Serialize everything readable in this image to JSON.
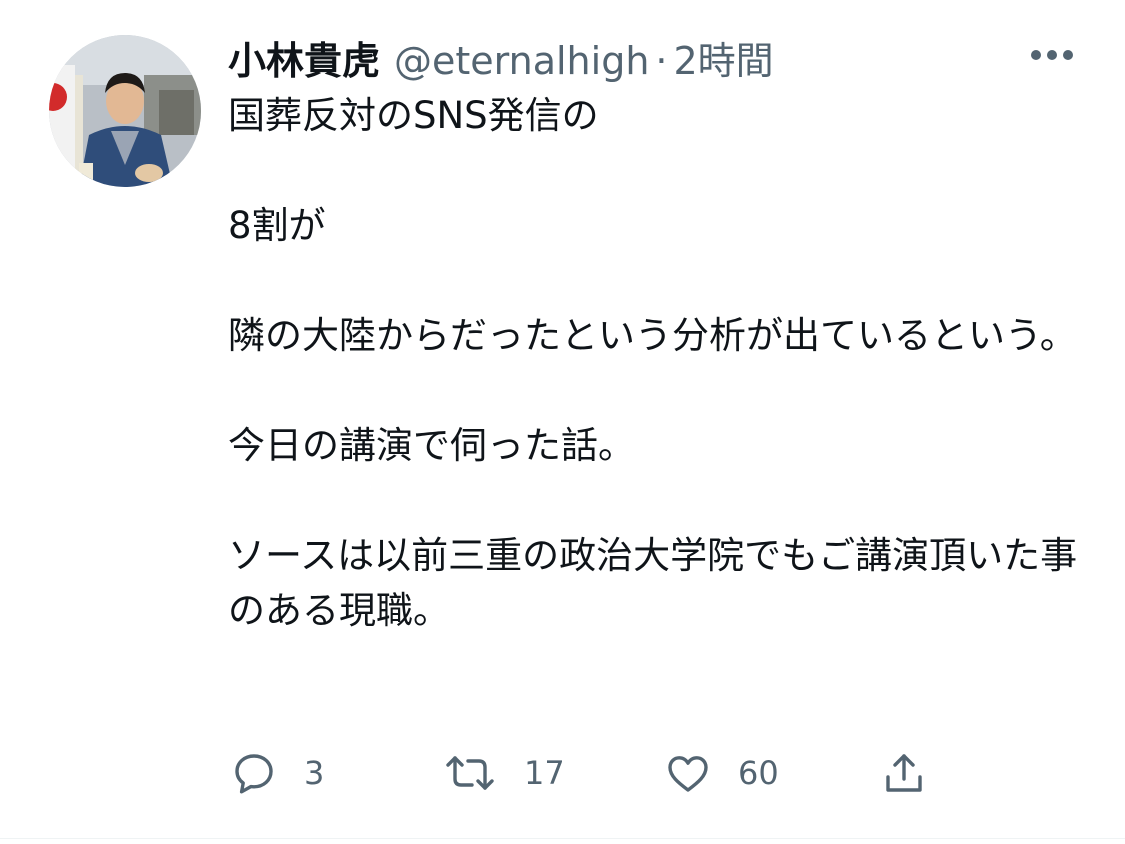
{
  "user": {
    "display_name": "小林貴虎",
    "handle": "@eternalhigh",
    "separator": "·",
    "timestamp": "2時間"
  },
  "tweet": {
    "text": "国葬反対のSNS発信の\n\n8割が\n\n隣の大陸からだったという分析が出ているという。\n\n今日の講演で伺った話。\n\nソースは以前三重の政治大学院でもご講演頂いた事のある現職。"
  },
  "actions": {
    "reply_count": "3",
    "retweet_count": "17",
    "like_count": "60"
  },
  "icons": {
    "more": "more-horizontal-icon",
    "reply": "reply-icon",
    "retweet": "retweet-icon",
    "like": "heart-icon",
    "share": "share-icon"
  },
  "colors": {
    "text_primary": "#0f1419",
    "text_secondary": "#536471",
    "icon_gray": "#536471"
  }
}
